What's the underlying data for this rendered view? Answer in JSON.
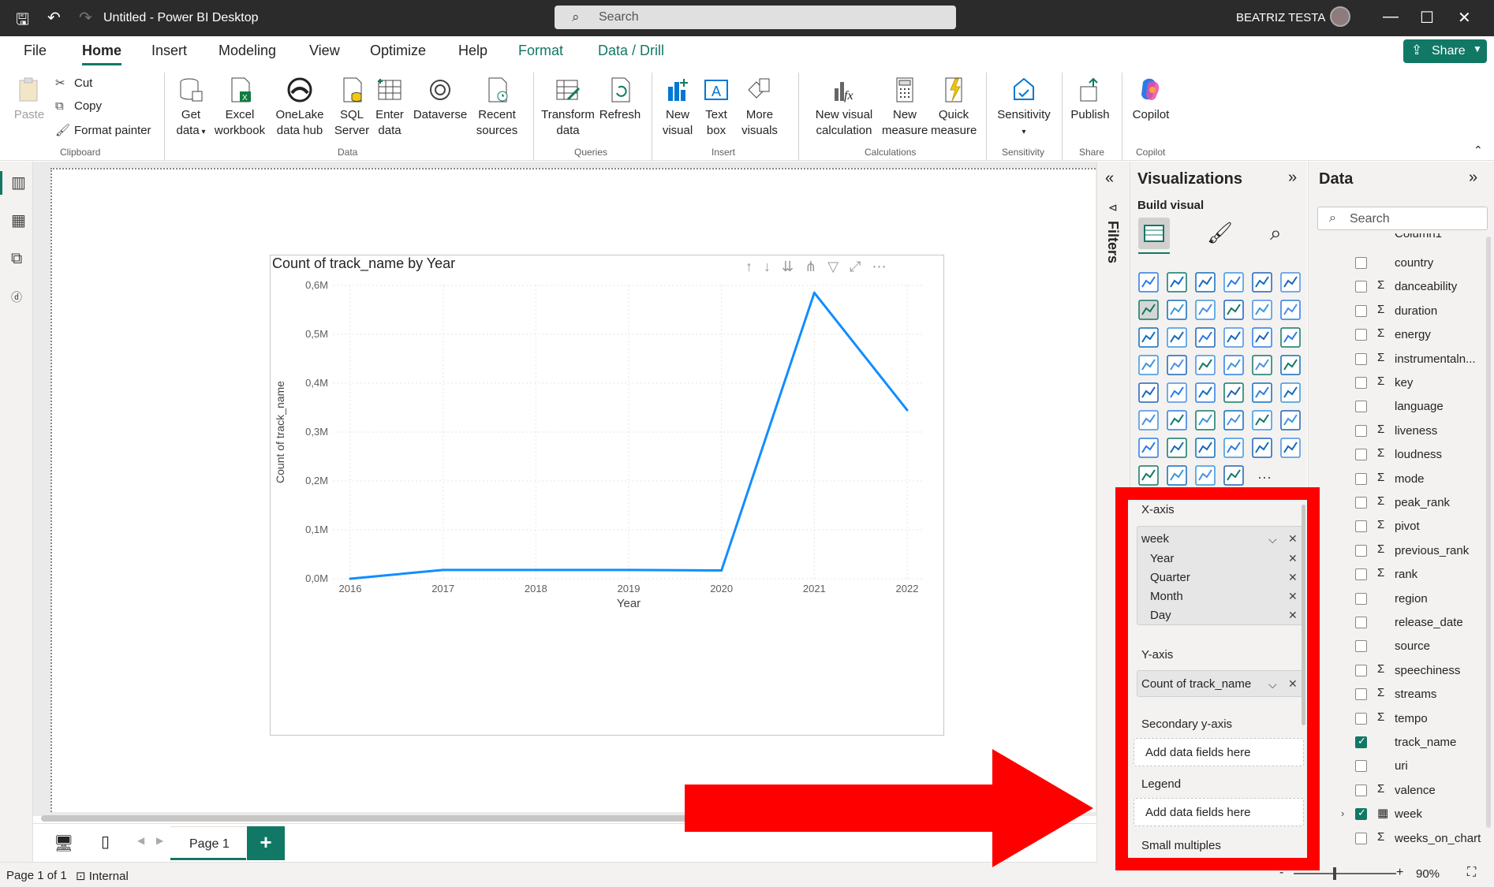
{
  "titlebar": {
    "title": "Untitled - Power BI Desktop",
    "search_placeholder": "Search",
    "user": "BEATRIZ TESTA"
  },
  "menu": {
    "tabs": [
      "File",
      "Home",
      "Insert",
      "Modeling",
      "View",
      "Optimize",
      "Help",
      "Format",
      "Data / Drill"
    ],
    "share_label": "Share"
  },
  "ribbon": {
    "clipboard": {
      "paste": "Paste",
      "cut": "Cut",
      "copy": "Copy",
      "format_painter": "Format painter",
      "group": "Clipboard"
    },
    "data": {
      "get_data": "Get data",
      "excel": "Excel workbook",
      "onelake": "OneLake data hub",
      "sql": "SQL Server",
      "enter": "Enter data",
      "dataverse": "Dataverse",
      "recent": "Recent sources",
      "group": "Data"
    },
    "queries": {
      "transform": "Transform data",
      "refresh": "Refresh",
      "group": "Queries"
    },
    "insert": {
      "new_visual": "New visual",
      "text_box": "Text box",
      "more_visuals": "More visuals",
      "group": "Insert"
    },
    "calculations": {
      "new_visual_calc": "New visual calculation",
      "new_measure": "New measure",
      "quick_measure": "Quick measure",
      "group": "Calculations"
    },
    "sensitivity": {
      "label": "Sensitivity",
      "group": "Sensitivity"
    },
    "share": {
      "publish": "Publish",
      "group": "Share"
    },
    "copilot": {
      "label": "Copilot",
      "group": "Copilot"
    }
  },
  "visual": {
    "title": "Count of track_name by Year"
  },
  "chart_data": {
    "type": "line",
    "title": "Count of track_name by Year",
    "xlabel": "Year",
    "ylabel": "Count of track_name",
    "categories": [
      "2016",
      "2017",
      "2018",
      "2019",
      "2020",
      "2021",
      "2022"
    ],
    "series": [
      {
        "values": [
          0.0,
          0.018,
          0.018,
          0.018,
          0.017,
          0.585,
          0.345
        ]
      }
    ],
    "y_ticks": [
      "0,0M",
      "0,1M",
      "0,2M",
      "0,3M",
      "0,4M",
      "0,5M",
      "0,6M"
    ],
    "ylim": [
      0,
      0.6
    ],
    "grid": true,
    "line_color": "#118DFF"
  },
  "pages": {
    "tab": "Page 1",
    "add": "+"
  },
  "status": {
    "page": "Page 1 of 1",
    "sensitivity": "Internal",
    "zoom": "90%"
  },
  "filters": {
    "label": "Filters"
  },
  "viz_pane": {
    "title": "Visualizations",
    "build_visual": "Build visual",
    "x_axis_label": "X-axis",
    "x_field": "week",
    "x_hierarchy": [
      "Year",
      "Quarter",
      "Month",
      "Day"
    ],
    "y_axis_label": "Y-axis",
    "y_field": "Count of track_name",
    "secondary_label": "Secondary y-axis",
    "secondary_placeholder": "Add data fields here",
    "legend_label": "Legend",
    "legend_placeholder": "Add data fields here",
    "small_multiples_label": "Small multiples"
  },
  "data_pane": {
    "title": "Data",
    "search_placeholder": "Search",
    "partial_top": "Column1",
    "fields": [
      {
        "name": "country",
        "sigma": false,
        "checked": false
      },
      {
        "name": "danceability",
        "sigma": true,
        "checked": false
      },
      {
        "name": "duration",
        "sigma": true,
        "checked": false
      },
      {
        "name": "energy",
        "sigma": true,
        "checked": false
      },
      {
        "name": "instrumentaln...",
        "sigma": true,
        "checked": false
      },
      {
        "name": "key",
        "sigma": true,
        "checked": false
      },
      {
        "name": "language",
        "sigma": false,
        "checked": false
      },
      {
        "name": "liveness",
        "sigma": true,
        "checked": false
      },
      {
        "name": "loudness",
        "sigma": true,
        "checked": false
      },
      {
        "name": "mode",
        "sigma": true,
        "checked": false
      },
      {
        "name": "peak_rank",
        "sigma": true,
        "checked": false
      },
      {
        "name": "pivot",
        "sigma": true,
        "checked": false
      },
      {
        "name": "previous_rank",
        "sigma": true,
        "checked": false
      },
      {
        "name": "rank",
        "sigma": true,
        "checked": false
      },
      {
        "name": "region",
        "sigma": false,
        "checked": false
      },
      {
        "name": "release_date",
        "sigma": false,
        "checked": false
      },
      {
        "name": "source",
        "sigma": false,
        "checked": false
      },
      {
        "name": "speechiness",
        "sigma": true,
        "checked": false
      },
      {
        "name": "streams",
        "sigma": true,
        "checked": false
      },
      {
        "name": "tempo",
        "sigma": true,
        "checked": false
      },
      {
        "name": "track_name",
        "sigma": false,
        "checked": true
      },
      {
        "name": "uri",
        "sigma": false,
        "checked": false
      },
      {
        "name": "valence",
        "sigma": true,
        "checked": false
      },
      {
        "name": "week",
        "sigma": false,
        "checked": true,
        "date": true
      },
      {
        "name": "weeks_on_chart",
        "sigma": true,
        "checked": false
      }
    ]
  },
  "colors": {
    "accent": "#117865",
    "highlight": "#FF0000",
    "line": "#118DFF"
  }
}
